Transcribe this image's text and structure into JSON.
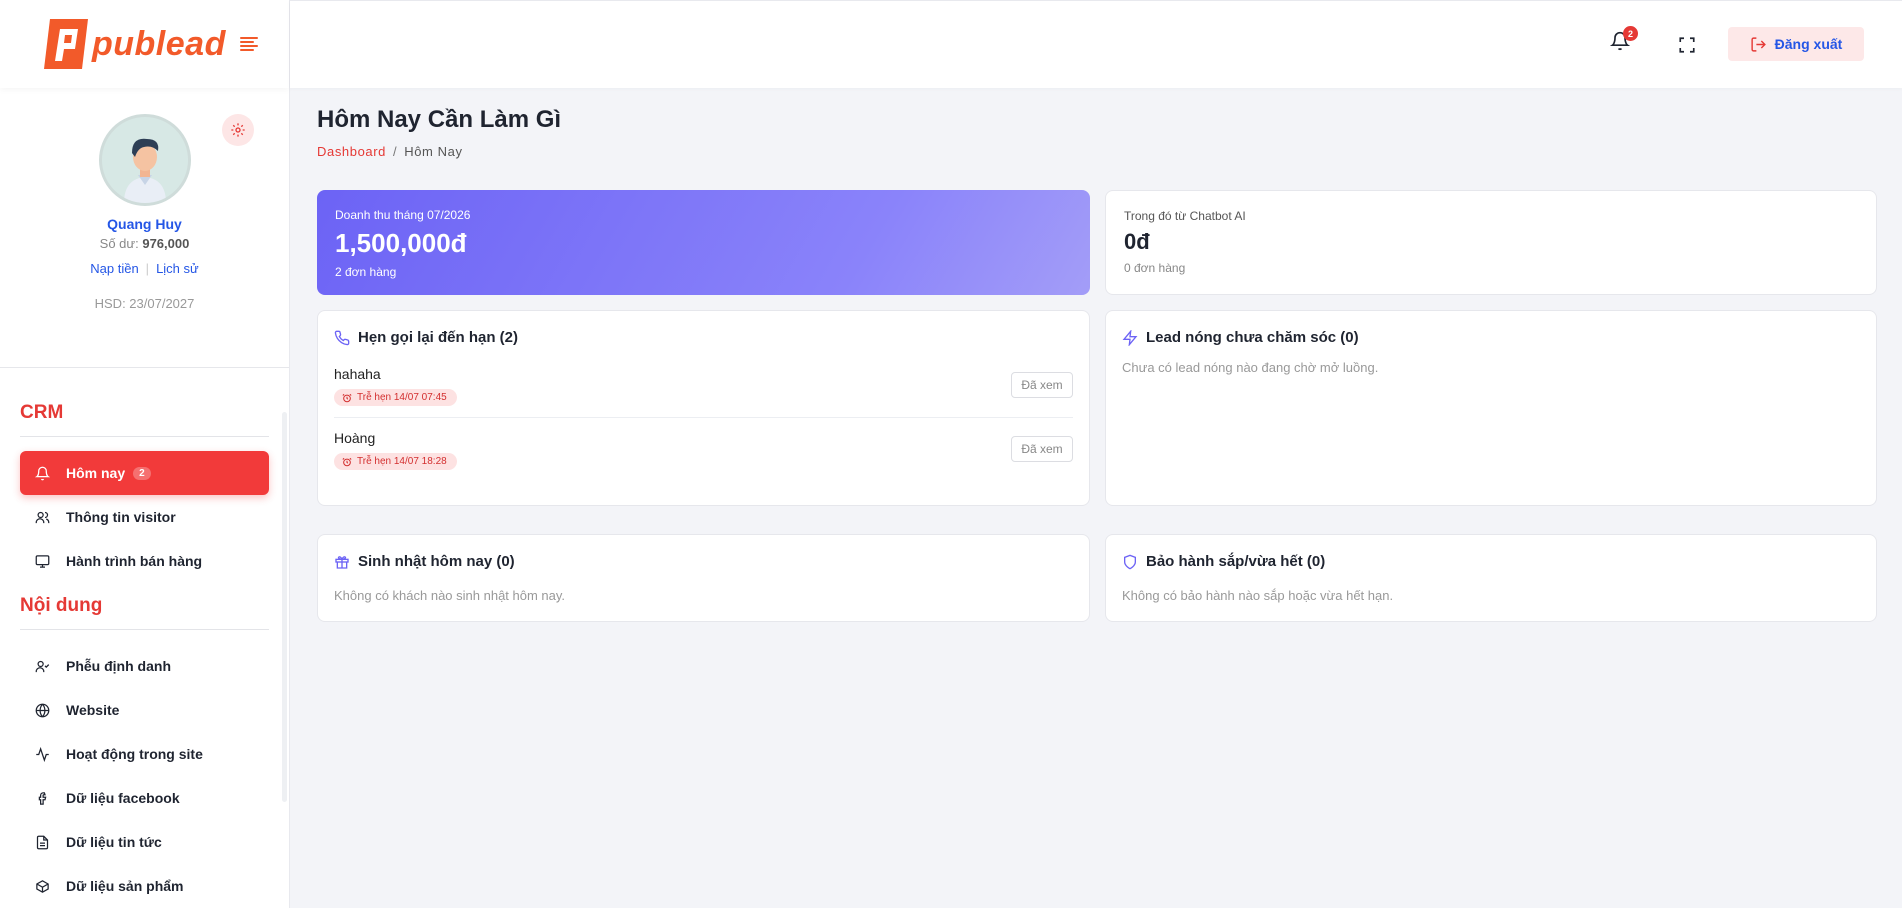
{
  "brand": {
    "logo_text": "publead",
    "accent": "#f25a2a",
    "danger": "#e53935",
    "link": "#2456e6"
  },
  "profile": {
    "name": "Quang Huy",
    "balance_label": "Số dư:",
    "balance_value": "976,000",
    "topup_label": "Nạp tiền",
    "history_label": "Lịch sử",
    "expiry": "HSD: 23/07/2027"
  },
  "sidebar": {
    "sections": [
      {
        "title": "CRM"
      },
      {
        "title": "Nội dung"
      }
    ],
    "crm_items": [
      {
        "label": "Hôm nay",
        "icon": "bell-icon",
        "badge": "2",
        "active": true
      },
      {
        "label": "Thông tin visitor",
        "icon": "users-icon"
      },
      {
        "label": "Hành trình bán hàng",
        "icon": "monitor-icon"
      }
    ],
    "content_items": [
      {
        "label": "Phễu định danh",
        "icon": "user-check-icon"
      },
      {
        "label": "Website",
        "icon": "globe-icon"
      },
      {
        "label": "Hoạt động trong site",
        "icon": "activity-icon"
      },
      {
        "label": "Dữ liệu facebook",
        "icon": "facebook-icon"
      },
      {
        "label": "Dữ liệu tin tức",
        "icon": "file-text-icon"
      },
      {
        "label": "Dữ liệu sản phẩm",
        "icon": "box-icon"
      }
    ]
  },
  "header": {
    "notification_count": "2",
    "logout_label": "Đăng xuất"
  },
  "page": {
    "title": "Hôm Nay Cần Làm Gì",
    "breadcrumb": {
      "root": "Dashboard",
      "separator": "/",
      "current": "Hôm Nay"
    }
  },
  "stats": {
    "revenue": {
      "label": "Doanh thu tháng 07/2026",
      "value": "1,500,000đ",
      "orders": "2 đơn hàng"
    },
    "chatbot": {
      "label": "Trong đó từ Chatbot AI",
      "value": "0đ",
      "orders": "0 đơn hàng"
    }
  },
  "callbacks": {
    "title": "Hẹn gọi lại đến hạn (2)",
    "mark_seen_label": "Đã xem",
    "items": [
      {
        "name": "hahaha",
        "tag": "Trễ hẹn 14/07 07:45"
      },
      {
        "name": "Hoàng",
        "tag": "Trễ hẹn 14/07 18:28"
      }
    ]
  },
  "hot_leads": {
    "title": "Lead nóng chưa chăm sóc (0)",
    "empty": "Chưa có lead nóng nào đang chờ mở luồng."
  },
  "birthdays": {
    "title": "Sinh nhật hôm nay (0)",
    "empty": "Không có khách nào sinh nhật hôm nay."
  },
  "warranty": {
    "title": "Bảo hành sắp/vừa hết (0)",
    "empty": "Không có bảo hành nào sắp hoặc vừa hết hạn."
  }
}
